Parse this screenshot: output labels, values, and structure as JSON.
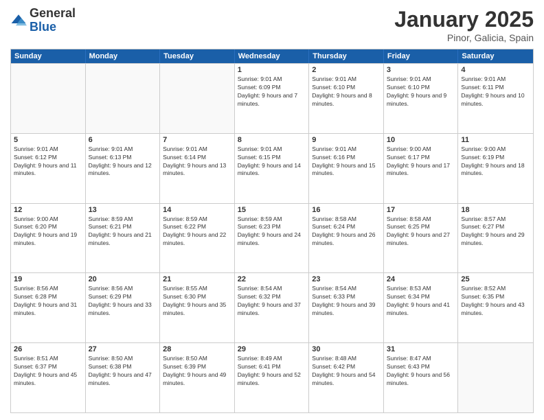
{
  "logo": {
    "general": "General",
    "blue": "Blue"
  },
  "header": {
    "month": "January 2025",
    "location": "Pinor, Galicia, Spain"
  },
  "days": [
    "Sunday",
    "Monday",
    "Tuesday",
    "Wednesday",
    "Thursday",
    "Friday",
    "Saturday"
  ],
  "rows": [
    [
      {
        "day": "",
        "text": ""
      },
      {
        "day": "",
        "text": ""
      },
      {
        "day": "",
        "text": ""
      },
      {
        "day": "1",
        "text": "Sunrise: 9:01 AM\nSunset: 6:09 PM\nDaylight: 9 hours and 7 minutes."
      },
      {
        "day": "2",
        "text": "Sunrise: 9:01 AM\nSunset: 6:10 PM\nDaylight: 9 hours and 8 minutes."
      },
      {
        "day": "3",
        "text": "Sunrise: 9:01 AM\nSunset: 6:10 PM\nDaylight: 9 hours and 9 minutes."
      },
      {
        "day": "4",
        "text": "Sunrise: 9:01 AM\nSunset: 6:11 PM\nDaylight: 9 hours and 10 minutes."
      }
    ],
    [
      {
        "day": "5",
        "text": "Sunrise: 9:01 AM\nSunset: 6:12 PM\nDaylight: 9 hours and 11 minutes."
      },
      {
        "day": "6",
        "text": "Sunrise: 9:01 AM\nSunset: 6:13 PM\nDaylight: 9 hours and 12 minutes."
      },
      {
        "day": "7",
        "text": "Sunrise: 9:01 AM\nSunset: 6:14 PM\nDaylight: 9 hours and 13 minutes."
      },
      {
        "day": "8",
        "text": "Sunrise: 9:01 AM\nSunset: 6:15 PM\nDaylight: 9 hours and 14 minutes."
      },
      {
        "day": "9",
        "text": "Sunrise: 9:01 AM\nSunset: 6:16 PM\nDaylight: 9 hours and 15 minutes."
      },
      {
        "day": "10",
        "text": "Sunrise: 9:00 AM\nSunset: 6:17 PM\nDaylight: 9 hours and 17 minutes."
      },
      {
        "day": "11",
        "text": "Sunrise: 9:00 AM\nSunset: 6:19 PM\nDaylight: 9 hours and 18 minutes."
      }
    ],
    [
      {
        "day": "12",
        "text": "Sunrise: 9:00 AM\nSunset: 6:20 PM\nDaylight: 9 hours and 19 minutes."
      },
      {
        "day": "13",
        "text": "Sunrise: 8:59 AM\nSunset: 6:21 PM\nDaylight: 9 hours and 21 minutes."
      },
      {
        "day": "14",
        "text": "Sunrise: 8:59 AM\nSunset: 6:22 PM\nDaylight: 9 hours and 22 minutes."
      },
      {
        "day": "15",
        "text": "Sunrise: 8:59 AM\nSunset: 6:23 PM\nDaylight: 9 hours and 24 minutes."
      },
      {
        "day": "16",
        "text": "Sunrise: 8:58 AM\nSunset: 6:24 PM\nDaylight: 9 hours and 26 minutes."
      },
      {
        "day": "17",
        "text": "Sunrise: 8:58 AM\nSunset: 6:25 PM\nDaylight: 9 hours and 27 minutes."
      },
      {
        "day": "18",
        "text": "Sunrise: 8:57 AM\nSunset: 6:27 PM\nDaylight: 9 hours and 29 minutes."
      }
    ],
    [
      {
        "day": "19",
        "text": "Sunrise: 8:56 AM\nSunset: 6:28 PM\nDaylight: 9 hours and 31 minutes."
      },
      {
        "day": "20",
        "text": "Sunrise: 8:56 AM\nSunset: 6:29 PM\nDaylight: 9 hours and 33 minutes."
      },
      {
        "day": "21",
        "text": "Sunrise: 8:55 AM\nSunset: 6:30 PM\nDaylight: 9 hours and 35 minutes."
      },
      {
        "day": "22",
        "text": "Sunrise: 8:54 AM\nSunset: 6:32 PM\nDaylight: 9 hours and 37 minutes."
      },
      {
        "day": "23",
        "text": "Sunrise: 8:54 AM\nSunset: 6:33 PM\nDaylight: 9 hours and 39 minutes."
      },
      {
        "day": "24",
        "text": "Sunrise: 8:53 AM\nSunset: 6:34 PM\nDaylight: 9 hours and 41 minutes."
      },
      {
        "day": "25",
        "text": "Sunrise: 8:52 AM\nSunset: 6:35 PM\nDaylight: 9 hours and 43 minutes."
      }
    ],
    [
      {
        "day": "26",
        "text": "Sunrise: 8:51 AM\nSunset: 6:37 PM\nDaylight: 9 hours and 45 minutes."
      },
      {
        "day": "27",
        "text": "Sunrise: 8:50 AM\nSunset: 6:38 PM\nDaylight: 9 hours and 47 minutes."
      },
      {
        "day": "28",
        "text": "Sunrise: 8:50 AM\nSunset: 6:39 PM\nDaylight: 9 hours and 49 minutes."
      },
      {
        "day": "29",
        "text": "Sunrise: 8:49 AM\nSunset: 6:41 PM\nDaylight: 9 hours and 52 minutes."
      },
      {
        "day": "30",
        "text": "Sunrise: 8:48 AM\nSunset: 6:42 PM\nDaylight: 9 hours and 54 minutes."
      },
      {
        "day": "31",
        "text": "Sunrise: 8:47 AM\nSunset: 6:43 PM\nDaylight: 9 hours and 56 minutes."
      },
      {
        "day": "",
        "text": ""
      }
    ]
  ]
}
